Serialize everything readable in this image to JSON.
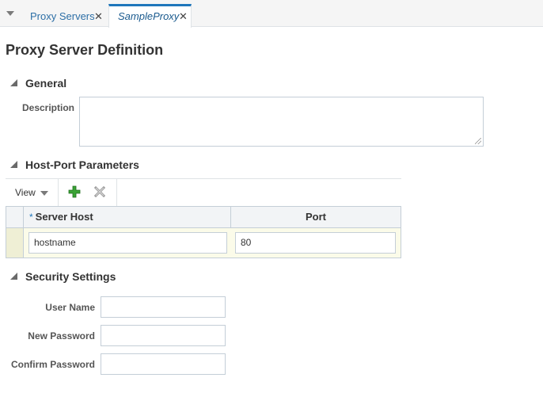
{
  "tabs": [
    {
      "label": "Proxy Servers",
      "close": "✕"
    },
    {
      "label": "SampleProxy",
      "close": "✕"
    }
  ],
  "page_title": "Proxy Server Definition",
  "general": {
    "heading": "General",
    "description_label": "Description",
    "description_value": ""
  },
  "host_port": {
    "heading": "Host-Port Parameters",
    "toolbar": {
      "view_label": "View",
      "add_icon": "add-icon",
      "delete_icon": "delete-icon"
    },
    "columns": {
      "required_marker": "*",
      "host": "Server Host",
      "port": "Port"
    },
    "rows": [
      {
        "host": "hostname",
        "port": "80"
      }
    ]
  },
  "security": {
    "heading": "Security Settings",
    "user_name_label": "User Name",
    "new_password_label": "New Password",
    "confirm_password_label": "Confirm Password",
    "user_name_value": "",
    "new_password_value": "",
    "confirm_password_value": ""
  },
  "colors": {
    "accent": "#1f77bb",
    "add_green": "#3aa335",
    "row_highlight": "#fbfbe9"
  }
}
